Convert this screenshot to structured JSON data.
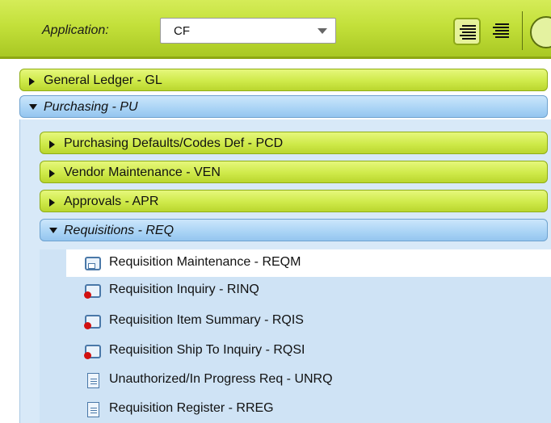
{
  "header": {
    "application_label": "Application:",
    "application_value": "CF",
    "toolbar_icons": [
      "indent-lines-icon",
      "outdent-lines-icon",
      "circle-button-icon"
    ]
  },
  "tree": {
    "general_ledger": "General Ledger - GL",
    "purchasing": "Purchasing - PU",
    "purchasing_children": {
      "pcd": "Purchasing Defaults/Codes Def - PCD",
      "ven": "Vendor Maintenance - VEN",
      "apr": "Approvals - APR",
      "req": "Requisitions - REQ"
    },
    "requisition_items": [
      {
        "label": "Requisition Maintenance - REQM",
        "icon": "window-icon"
      },
      {
        "label": "Requisition Inquiry - RINQ",
        "icon": "alert-window-icon"
      },
      {
        "label": "Requisition Item Summary - RQIS",
        "icon": "alert-window-icon"
      },
      {
        "label": "Requisition Ship To Inquiry - RQSI",
        "icon": "alert-window-icon"
      },
      {
        "label": "Unauthorized/In Progress Req - UNRQ",
        "icon": "document-icon"
      },
      {
        "label": "Requisition Register - RREG",
        "icon": "document-icon"
      }
    ]
  },
  "colors": {
    "green_bar": "#cfea4a",
    "blue_bar": "#a9d3f5",
    "panel_blue": "#d8e9f8"
  }
}
